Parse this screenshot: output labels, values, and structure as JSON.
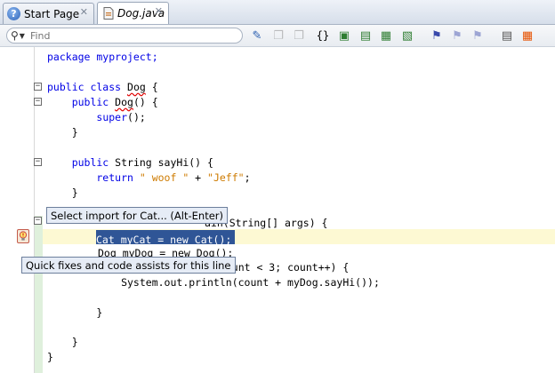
{
  "tabs": [
    {
      "label": "Start Page",
      "close": "✕"
    },
    {
      "label": "Dog.java",
      "close": "✕"
    }
  ],
  "toolbar": {
    "find_placeholder": "Find",
    "icons": [
      "toggle-highlight-icon",
      "shift-left-icon",
      "shift-right-icon",
      "match-brace-icon",
      "toggle-comment-icon",
      "uncomment-icon",
      "insert-code-icon",
      "fix-imports-icon",
      "toggle-bookmark-icon",
      "prev-bookmark-icon",
      "next-bookmark-icon",
      "start-macro-icon",
      "stop-macro-icon"
    ]
  },
  "code": {
    "l1": "package myproject;",
    "l3a": "public class ",
    "l3b": "Dog",
    "l3c": " {",
    "l4a": "    public ",
    "l4b": "Dog",
    "l4c": "() {",
    "l5a": "        ",
    "l5b": "super",
    "l5c": "();",
    "l6": "    }",
    "l8a": "    public ",
    "l8b": "String sayHi() {",
    "l9a": "        return ",
    "l9b": "\" woof \"",
    "l9c": " + ",
    "l9d": "\"Jeff\"",
    "l9e": ";",
    "l10": "    }",
    "l12": "ain(String[] args) {",
    "l13": "Cat myCat = new Cat();",
    "l14a": "Dog myDog = new ",
    "l14b": "Dog",
    "l14c": "();",
    "l15": " count < 3; count++) {",
    "l16": "            System.out.println(count + myDog.sayHi());",
    "l18": "        }",
    "l20": "    }",
    "l21": "}"
  },
  "tooltips": {
    "import": "Select import for Cat... (Alt-Enter)",
    "quickfix": "Quick fixes and code assists for this line"
  },
  "colors": {
    "keyword": "#0000e6",
    "string": "#ce7b00",
    "selection": "#2f5596",
    "current_line": "#fdf9d3"
  }
}
